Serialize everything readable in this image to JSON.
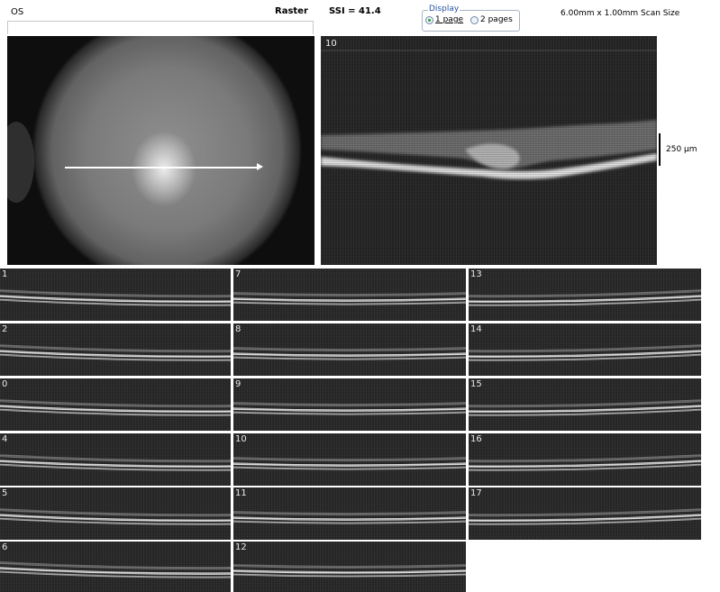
{
  "header": {
    "eye": "OS",
    "scan_type": "Raster",
    "ssi": "SSI = 41.4",
    "scan_size": "6.00mm x 1.00mm Scan Size"
  },
  "display": {
    "legend": "Display",
    "options": [
      {
        "label": "1 page",
        "selected": true
      },
      {
        "label": "2 pages",
        "selected": false
      }
    ]
  },
  "main_scan": {
    "label": "10",
    "scale_label": "250 µm"
  },
  "thumbnails": [
    "1",
    "7",
    "13",
    "2",
    "8",
    "14",
    "0",
    "9",
    "15",
    "4",
    "10",
    "16",
    "5",
    "11",
    "17",
    "6",
    "12"
  ]
}
